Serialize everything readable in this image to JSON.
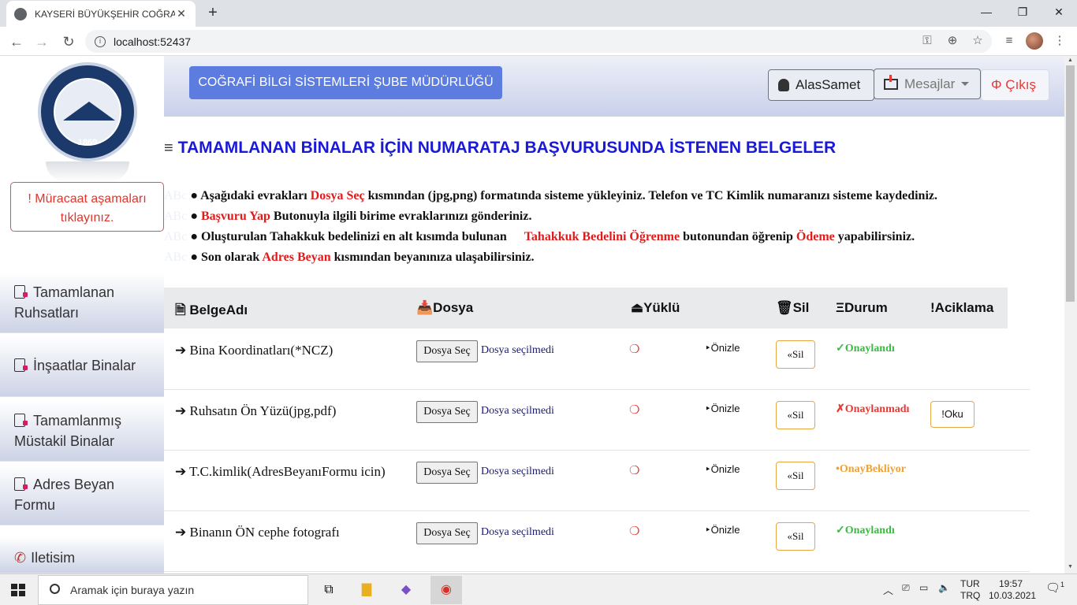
{
  "browser": {
    "tab_title": "KAYSERİ BÜYÜKŞEHİR COĞRAFİ B",
    "url": "localhost:52437"
  },
  "sidebar": {
    "logo_year": "1869",
    "notice": "! Müracaat aşamaları tıklayınız.",
    "items": [
      {
        "label": "Tamamlanan Ruhsatları"
      },
      {
        "label": "İnşaatlar Binalar"
      },
      {
        "label": "Tamamlanmış Müstakil Binalar"
      },
      {
        "label": "Adres Beyan Formu"
      },
      {
        "label": "Iletisim"
      }
    ]
  },
  "header": {
    "title_button": "COĞRAFİ BİLGİ SİSTEMLERİ ŞUBE MÜDÜRLÜĞÜ",
    "user": "AlasSamet",
    "messages": "Mesajlar",
    "logout": "Φ Çıkış"
  },
  "main": {
    "heading": "TAMAMLANAN BİNALAR İÇİN NUMARATAJ BAŞVURUSUNDA İSTENEN BELGELER",
    "ghost": "ABc",
    "instructions": {
      "l1a": "● Aşağıdaki evrakları ",
      "l1b": "Dosya Seç",
      "l1c": " kısmından (jpg,png) formatında sisteme yükleyiniz. Telefon ve TC Kimlik numaranızı sisteme kaydediniz.",
      "l2a": "● ",
      "l2b": "Başvuru Yap",
      "l2c": " Butonuyla ilgili birime evraklarınızı gönderiniz.",
      "l3a": "● Oluşturulan Tahakkuk bedelinizi en alt kısımda bulunan ",
      "l3b": "Tahakkuk Bedelini Öğrenme",
      "l3c": " butonundan öğrenip ",
      "l3d": "Ödeme",
      "l3e": " yapabilirsiniz.",
      "l4a": "● Son olarak ",
      "l4b": "Adres Beyan",
      "l4c": " kısmından beyanınıza ulaşabilirsiniz."
    },
    "table": {
      "headers": [
        "BelgeAdı",
        "Dosya",
        "Yüklü",
        "Sil",
        "Durum",
        "Aciklama"
      ],
      "file_button": "Dosya Seç",
      "no_file": "Dosya seçilmedi",
      "uploaded_mark": "❍",
      "preview": "‣Önizle",
      "delete": "«Sil",
      "rows": [
        {
          "name": "➔ Bina Koordinatları(*NCZ)",
          "status": "✓Onaylandı",
          "status_color": "#3cb843",
          "note": ""
        },
        {
          "name": "➔ Ruhsatın Ön Yüzü(jpg,pdf)",
          "status": "✗Onaylanmadı",
          "status_color": "#e53935",
          "note": "!Oku"
        },
        {
          "name": "➔ T.C.kimlik(AdresBeyanıFormu icin)",
          "status": "•OnayBekliyor",
          "status_color": "#f0a030",
          "note": ""
        },
        {
          "name": "➔ Binanın ÖN cephe fotografı",
          "status": "✓Onaylandı",
          "status_color": "#3cb843",
          "note": ""
        }
      ]
    }
  },
  "taskbar": {
    "search_placeholder": "Aramak için buraya yazın",
    "lang1": "TUR",
    "lang2": "TRQ",
    "time": "19:57",
    "date": "10.03.2021",
    "notif_count": "1"
  }
}
